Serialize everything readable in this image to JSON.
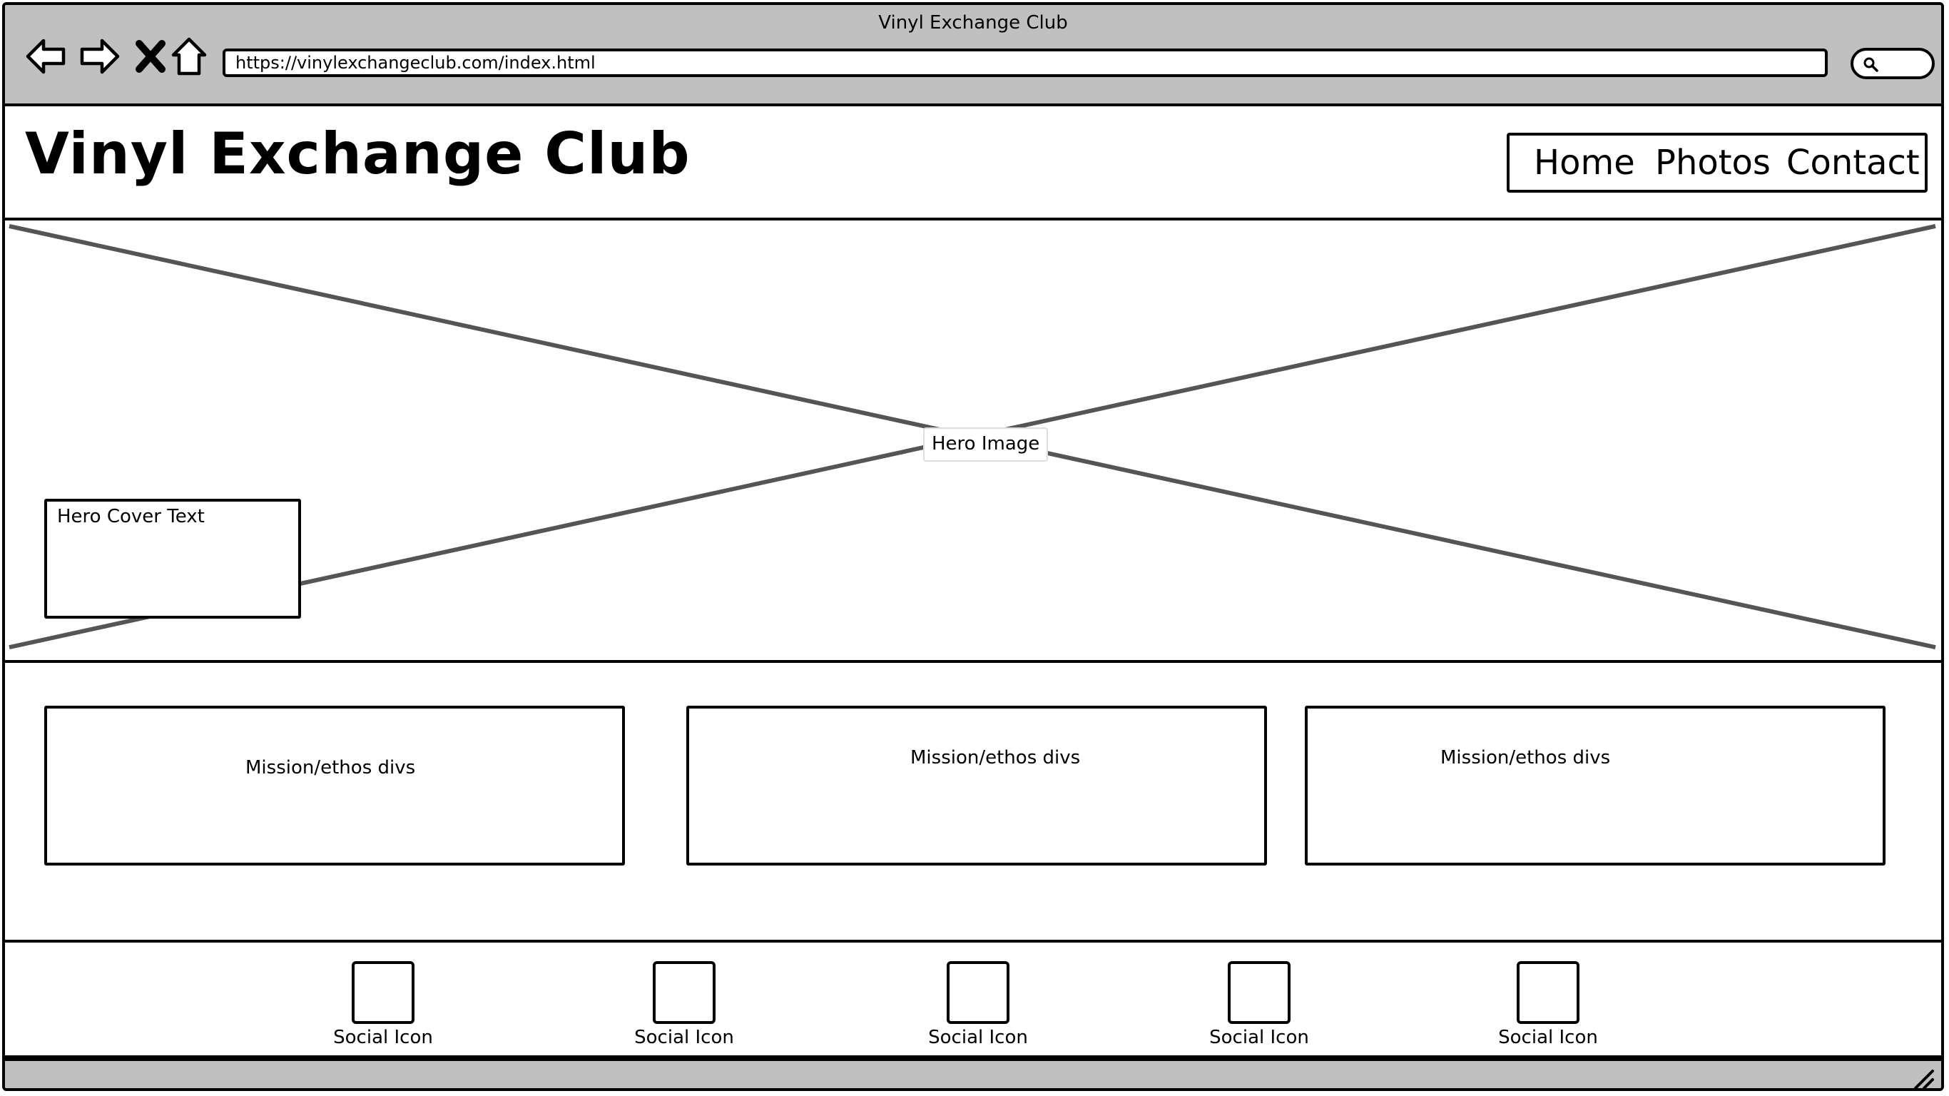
{
  "browser": {
    "window_title": "Vinyl Exchange Club",
    "url": "https://vinylexchangeclub.com/index.html",
    "buttons": [
      "back-arrow-icon",
      "forward-arrow-icon",
      "close-x-icon",
      "home-icon"
    ],
    "search_icon": "search-icon"
  },
  "header": {
    "site_title": "Vinyl Exchange Club",
    "nav": [
      "Home",
      "Photos",
      "Contact"
    ]
  },
  "hero": {
    "image_label": "Hero Image",
    "cover_text": "Hero Cover Text"
  },
  "mission": {
    "cards": [
      "Mission/ethos divs",
      "Mission/ethos divs",
      "Mission/ethos divs"
    ]
  },
  "footer": {
    "social": [
      "Social Icon",
      "Social Icon",
      "Social Icon",
      "Social Icon",
      "Social Icon"
    ]
  }
}
